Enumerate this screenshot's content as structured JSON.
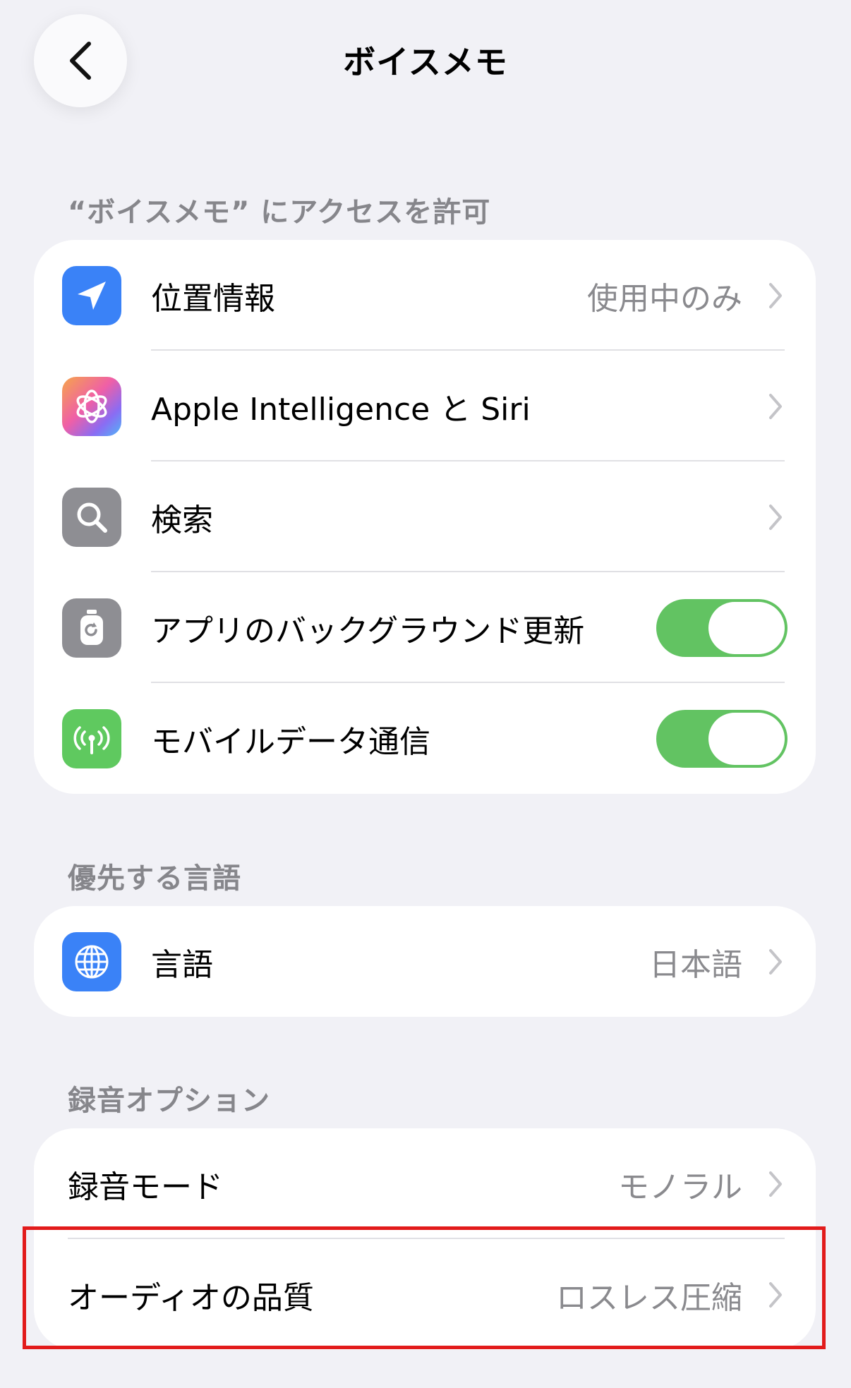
{
  "header": {
    "title": "ボイスメモ",
    "back_icon": "chevron-left-icon"
  },
  "sections": {
    "access": {
      "header": "“ボイスメモ” にアクセスを許可",
      "items": [
        {
          "label": "位置情報",
          "value": "使用中のみ",
          "icon": "location-arrow-icon",
          "icon_color": "#3a82f7"
        },
        {
          "label": "Apple Intelligence と Siri",
          "icon": "apple-intelligence-icon"
        },
        {
          "label": "検索",
          "icon": "search-icon",
          "icon_color": "#8e8e93"
        },
        {
          "label": "アプリのバックグラウンド更新",
          "icon": "background-refresh-icon",
          "icon_color": "#8e8e93",
          "toggle": true
        },
        {
          "label": "モバイルデータ通信",
          "icon": "cellular-antenna-icon",
          "icon_color": "#5fc95f",
          "toggle": true
        }
      ]
    },
    "language": {
      "header": "優先する言語",
      "items": [
        {
          "label": "言語",
          "value": "日本語",
          "icon": "globe-icon",
          "icon_color": "#3a82f7"
        }
      ]
    },
    "recording": {
      "header": "録音オプション",
      "items": [
        {
          "label": "録音モード",
          "value": "モノラル"
        },
        {
          "label": "オーディオの品質",
          "value": "ロスレス圧縮"
        }
      ]
    }
  },
  "colors": {
    "background": "#f1f1f6",
    "toggle_on": "#62c362",
    "highlight": "#e21b1b",
    "secondary_text": "#8a8a8e"
  }
}
